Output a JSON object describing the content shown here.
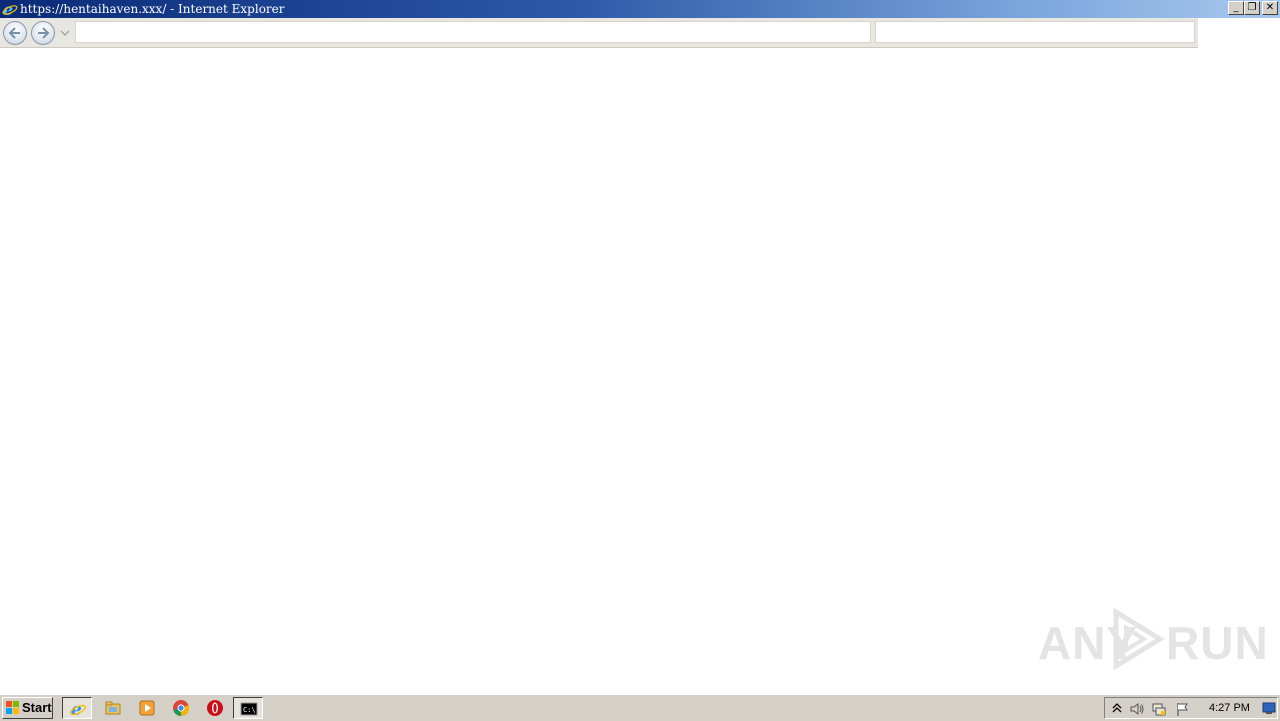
{
  "window": {
    "title": "https://hentaihaven.xxx/ - Internet Explorer",
    "controls": [
      "minimize",
      "restore",
      "close"
    ]
  },
  "navigation": {
    "back_icon": "back-arrow-icon",
    "forward_icon": "forward-arrow-icon",
    "address_value": "",
    "search_value": ""
  },
  "watermark": {
    "left_text": "ANY",
    "right_text": "RUN"
  },
  "taskbar": {
    "start_label": "Start",
    "pinned": [
      "internet-explorer-icon",
      "file-explorer-icon",
      "media-player-icon",
      "chrome-icon",
      "opera-icon",
      "command-prompt-icon"
    ],
    "tray_icons": [
      "show-hidden-icons-icon",
      "volume-icon",
      "network-icon",
      "action-center-flag-icon"
    ],
    "clock": "4:27 PM"
  },
  "colors": {
    "titlebar_start": "#0a2a78",
    "titlebar_end": "#a9c8ee",
    "taskbar": "#d4d0c8",
    "watermark": "#e4e4e4"
  }
}
